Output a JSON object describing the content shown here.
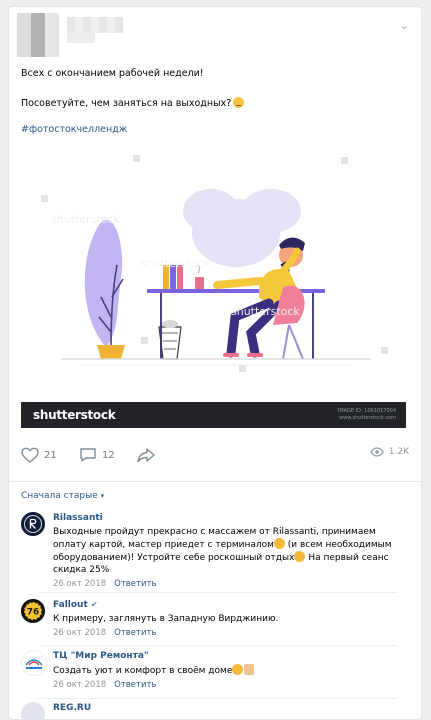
{
  "post": {
    "line1": "Всех с окончанием рабочей недели!",
    "line2": "Посоветуйте, чем заняться на выходных?",
    "hashtag": "#фотостокчеллендж",
    "image": {
      "watermark_logo": "shutterstock",
      "image_id": "IMAGE ID: 1061017004",
      "site": "www.shutterstock.com"
    }
  },
  "actions": {
    "likes": "21",
    "comments": "12",
    "views": "1.2K"
  },
  "comments_sort": "Сначала старые",
  "comments": [
    {
      "author": "Rilassanti",
      "text_a": "Выходные пройдут прекрасно с массажем от Rilassanti, принимаем оплату картой, мастер приедет с терминалом",
      "text_b": " (и всем необходимым оборудованием)! Устройте себе роскошный отдых",
      "text_c": " На первый сеанс скидка 25%",
      "date": "26 окт 2018",
      "reply": "Ответить"
    },
    {
      "author": "Fallout",
      "text": "К примеру, заглянуть в Западную Вирджинию.",
      "date": "26 окт 2018",
      "reply": "Ответить"
    },
    {
      "author": "ТЦ \"Мир Ремонта\"",
      "text": "Создать уют и комфорт в своём доме",
      "date": "26 окт 2018",
      "reply": "Ответить"
    },
    {
      "author": "REG.RU"
    }
  ],
  "colors": {
    "link": "#2a5885",
    "muted": "#939393",
    "icon": "#6e7b8b",
    "accent_yellow": "#f6c440",
    "illustration_purple": "#6a57d6"
  }
}
